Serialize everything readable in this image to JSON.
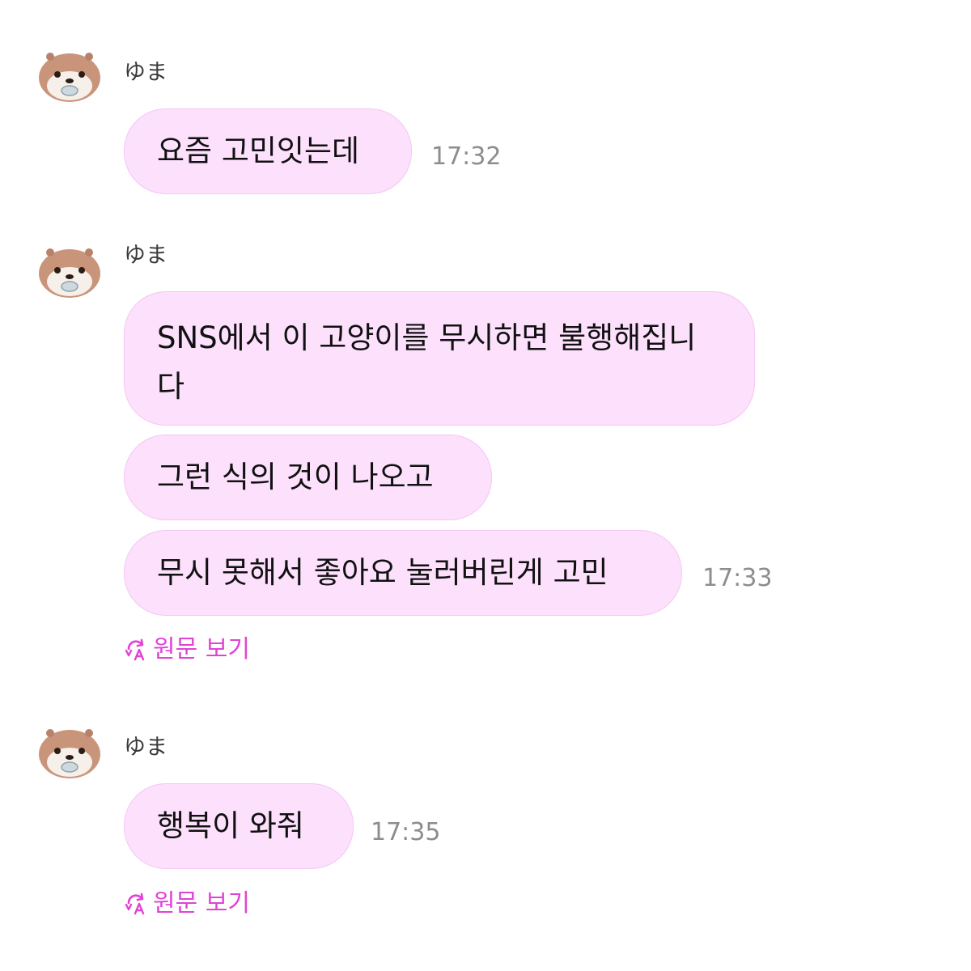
{
  "messages": [
    {
      "sender": "ゆま",
      "bubbles": [
        "요즘 고민잇는데"
      ],
      "time": "17:32"
    },
    {
      "sender": "ゆま",
      "bubbles": [
        "SNS에서 이 고양이를 무시하면 불행해집니다",
        "그런 식의 것이 나오고",
        "무시 못해서 좋아요 눌러버린게 고민"
      ],
      "time": "17:33",
      "original_link": "원문 보기"
    },
    {
      "sender": "ゆま",
      "bubbles": [
        "행복이 와줘"
      ],
      "time": "17:35",
      "original_link": "원문 보기"
    }
  ],
  "icons": {
    "avatar": "otter-avatar-icon",
    "translate": "translate-icon"
  },
  "colors": {
    "bubble_bg": "#fce0fc",
    "link": "#e243d6",
    "time": "#8d8d8d"
  }
}
